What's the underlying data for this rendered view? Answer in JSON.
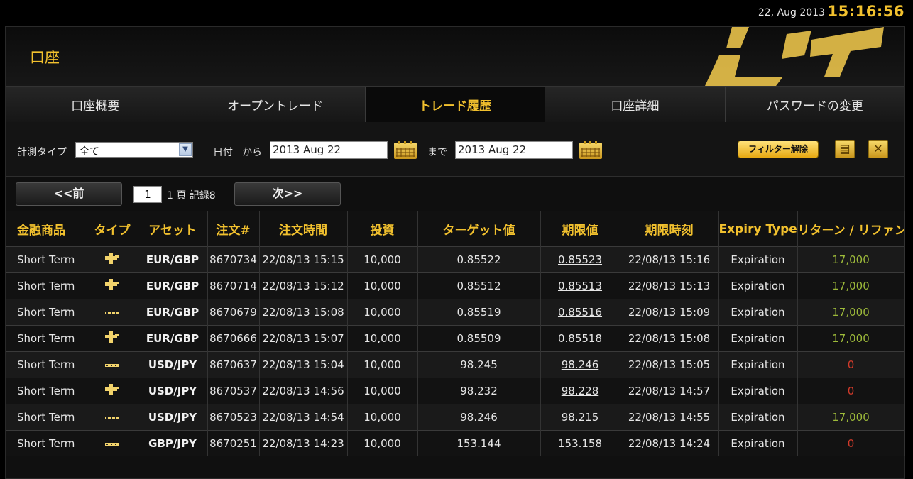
{
  "topbar": {
    "date": "22, Aug 2013",
    "time": "15:16:56"
  },
  "header": {
    "title": "口座"
  },
  "tabs": [
    {
      "label": "口座概要"
    },
    {
      "label": "オープントレード"
    },
    {
      "label": "トレード履歴"
    },
    {
      "label": "口座詳細"
    },
    {
      "label": "パスワードの変更"
    }
  ],
  "filters": {
    "type_label": "計測タイプ",
    "type_value": "全て",
    "date_label": "日付",
    "from_label": "から",
    "from_value": "2013 Aug 22",
    "to_label": "まで",
    "to_value": "2013 Aug 22",
    "clear_label": "フィルター解除",
    "print_icon": "print-icon",
    "excel_icon": "excel-export-icon"
  },
  "pager": {
    "prev_label": "<<前",
    "page_value": "1",
    "info": "1 頁 記録8",
    "next_label": "次>>"
  },
  "table": {
    "columns": [
      "金融商品",
      "タイプ",
      "アセット",
      "注文#",
      "注文時間",
      "投資",
      "ターゲット値",
      "期限値",
      "期限時刻",
      "Expiry Type",
      "リターン / リファンド"
    ],
    "rows": [
      [
        "Short Term",
        "call",
        "EUR/GBP",
        "8670734",
        "22/08/13 15:15",
        "10,000",
        "0.85522",
        "0.85523",
        "22/08/13 15:16",
        "Expiration",
        "17,000"
      ],
      [
        "Short Term",
        "call",
        "EUR/GBP",
        "8670714",
        "22/08/13 15:12",
        "10,000",
        "0.85512",
        "0.85513",
        "22/08/13 15:13",
        "Expiration",
        "17,000"
      ],
      [
        "Short Term",
        "put",
        "EUR/GBP",
        "8670679",
        "22/08/13 15:08",
        "10,000",
        "0.85519",
        "0.85516",
        "22/08/13 15:09",
        "Expiration",
        "17,000"
      ],
      [
        "Short Term",
        "call",
        "EUR/GBP",
        "8670666",
        "22/08/13 15:07",
        "10,000",
        "0.85509",
        "0.85518",
        "22/08/13 15:08",
        "Expiration",
        "17,000"
      ],
      [
        "Short Term",
        "put",
        "USD/JPY",
        "8670637",
        "22/08/13 15:04",
        "10,000",
        "98.245",
        "98.246",
        "22/08/13 15:05",
        "Expiration",
        "0"
      ],
      [
        "Short Term",
        "call",
        "USD/JPY",
        "8670537",
        "22/08/13 14:56",
        "10,000",
        "98.232",
        "98.228",
        "22/08/13 14:57",
        "Expiration",
        "0"
      ],
      [
        "Short Term",
        "put",
        "USD/JPY",
        "8670523",
        "22/08/13 14:54",
        "10,000",
        "98.246",
        "98.215",
        "22/08/13 14:55",
        "Expiration",
        "17,000"
      ],
      [
        "Short Term",
        "put",
        "GBP/JPY",
        "8670251",
        "22/08/13 14:23",
        "10,000",
        "153.144",
        "153.158",
        "22/08/13 14:24",
        "Expiration",
        "0"
      ]
    ]
  },
  "colors": {
    "accent": "#f2c12e",
    "win": "#9dba3a",
    "loss": "#d23a2a"
  }
}
